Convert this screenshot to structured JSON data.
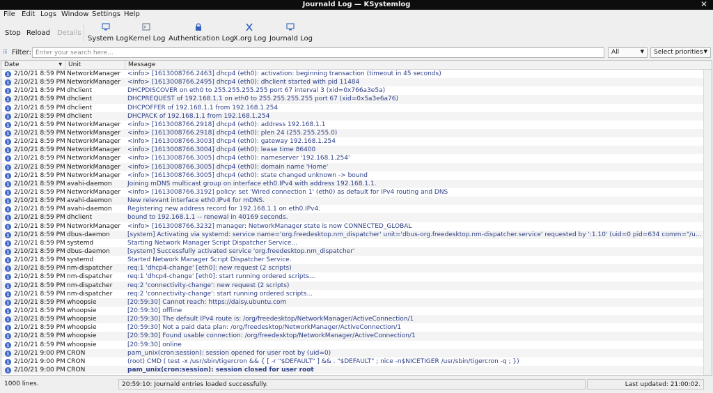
{
  "window": {
    "title": "Journald Log — KSystemlog"
  },
  "menu": [
    "File",
    "Edit",
    "Logs",
    "Window",
    "Settings",
    "Help"
  ],
  "toolbar": {
    "stop": "Stop",
    "reload": "Reload",
    "details": "Details",
    "logs": [
      {
        "label": "System Log",
        "icon": "monitor-icon"
      },
      {
        "label": "Kernel Log",
        "icon": "terminal-icon"
      },
      {
        "label": "Authentication Log",
        "icon": "lock-icon"
      },
      {
        "label": "X.org Log",
        "icon": "xorg-icon"
      },
      {
        "label": "Journald Log",
        "icon": "monitor-icon"
      }
    ]
  },
  "filter": {
    "label": "Filter:",
    "placeholder": "Enter your search here...",
    "column_select": "All",
    "priority_select": "Select priorities"
  },
  "table": {
    "columns": [
      "Date",
      "Unit",
      "Message"
    ],
    "rows": [
      {
        "date": "2/10/21 8:59 PM",
        "unit": "NetworkManager",
        "msg": "<info>  [1613008766.2463] dhcp4 (eth0): activation: beginning transaction (timeout in 45 seconds)"
      },
      {
        "date": "2/10/21 8:59 PM",
        "unit": "NetworkManager",
        "msg": "<info>  [1613008766.2495] dhcp4 (eth0): dhclient started with pid 11484"
      },
      {
        "date": "2/10/21 8:59 PM",
        "unit": "dhclient",
        "msg": "DHCPDISCOVER on eth0 to 255.255.255.255 port 67 interval 3 (xid=0x766a3e5a)"
      },
      {
        "date": "2/10/21 8:59 PM",
        "unit": "dhclient",
        "msg": "DHCPREQUEST of 192.168.1.1 on eth0 to 255.255.255.255 port 67 (xid=0x5a3e6a76)"
      },
      {
        "date": "2/10/21 8:59 PM",
        "unit": "dhclient",
        "msg": "DHCPOFFER of 192.168.1.1 from 192.168.1.254"
      },
      {
        "date": "2/10/21 8:59 PM",
        "unit": "dhclient",
        "msg": "DHCPACK of 192.168.1.1 from 192.168.1.254"
      },
      {
        "date": "2/10/21 8:59 PM",
        "unit": "NetworkManager",
        "msg": "<info>  [1613008766.2918] dhcp4 (eth0):   address 192.168.1.1"
      },
      {
        "date": "2/10/21 8:59 PM",
        "unit": "NetworkManager",
        "msg": "<info>  [1613008766.2918] dhcp4 (eth0):   plen 24 (255.255.255.0)"
      },
      {
        "date": "2/10/21 8:59 PM",
        "unit": "NetworkManager",
        "msg": "<info>  [1613008766.3003] dhcp4 (eth0):   gateway 192.168.1.254"
      },
      {
        "date": "2/10/21 8:59 PM",
        "unit": "NetworkManager",
        "msg": "<info>  [1613008766.3004] dhcp4 (eth0):   lease time 86400"
      },
      {
        "date": "2/10/21 8:59 PM",
        "unit": "NetworkManager",
        "msg": "<info>  [1613008766.3005] dhcp4 (eth0):   nameserver '192.168.1.254'"
      },
      {
        "date": "2/10/21 8:59 PM",
        "unit": "NetworkManager",
        "msg": "<info>  [1613008766.3005] dhcp4 (eth0):   domain name 'Home'"
      },
      {
        "date": "2/10/21 8:59 PM",
        "unit": "NetworkManager",
        "msg": "<info>  [1613008766.3005] dhcp4 (eth0): state changed unknown -> bound"
      },
      {
        "date": "2/10/21 8:59 PM",
        "unit": "avahi-daemon",
        "msg": "Joining mDNS multicast group on interface eth0.IPv4 with address 192.168.1.1."
      },
      {
        "date": "2/10/21 8:59 PM",
        "unit": "NetworkManager",
        "msg": "<info>  [1613008766.3192] policy: set 'Wired connection 1' (eth0) as default for IPv4 routing and DNS"
      },
      {
        "date": "2/10/21 8:59 PM",
        "unit": "avahi-daemon",
        "msg": "New relevant interface eth0.IPv4 for mDNS."
      },
      {
        "date": "2/10/21 8:59 PM",
        "unit": "avahi-daemon",
        "msg": "Registering new address record for 192.168.1.1 on eth0.IPv4."
      },
      {
        "date": "2/10/21 8:59 PM",
        "unit": "dhclient",
        "msg": "bound to 192.168.1.1 -- renewal in 40169 seconds."
      },
      {
        "date": "2/10/21 8:59 PM",
        "unit": "NetworkManager",
        "msg": "<info>  [1613008766.3232] manager: NetworkManager state is now CONNECTED_GLOBAL"
      },
      {
        "date": "2/10/21 8:59 PM",
        "unit": "dbus-daemon",
        "msg": "[system] Activating via systemd: service name='org.freedesktop.nm_dispatcher' unit='dbus-org.freedesktop.nm-dispatcher.service' requested by ':1.10' (uid=0 pid=634 comm=\"/usr/sbin/Net..."
      },
      {
        "date": "2/10/21 8:59 PM",
        "unit": "systemd",
        "msg": "Starting Network Manager Script Dispatcher Service..."
      },
      {
        "date": "2/10/21 8:59 PM",
        "unit": "dbus-daemon",
        "msg": "[system] Successfully activated service 'org.freedesktop.nm_dispatcher'"
      },
      {
        "date": "2/10/21 8:59 PM",
        "unit": "systemd",
        "msg": "Started Network Manager Script Dispatcher Service."
      },
      {
        "date": "2/10/21 8:59 PM",
        "unit": "nm-dispatcher",
        "msg": "req:1 'dhcp4-change' [eth0]: new request (2 scripts)"
      },
      {
        "date": "2/10/21 8:59 PM",
        "unit": "nm-dispatcher",
        "msg": "req:1 'dhcp4-change' [eth0]: start running ordered scripts..."
      },
      {
        "date": "2/10/21 8:59 PM",
        "unit": "nm-dispatcher",
        "msg": "req:2 'connectivity-change': new request (2 scripts)"
      },
      {
        "date": "2/10/21 8:59 PM",
        "unit": "nm-dispatcher",
        "msg": "req:2 'connectivity-change': start running ordered scripts..."
      },
      {
        "date": "2/10/21 8:59 PM",
        "unit": "whoopsie",
        "msg": "[20:59:30] Cannot reach: https://daisy.ubuntu.com"
      },
      {
        "date": "2/10/21 8:59 PM",
        "unit": "whoopsie",
        "msg": "[20:59:30] offline"
      },
      {
        "date": "2/10/21 8:59 PM",
        "unit": "whoopsie",
        "msg": "[20:59:30] The default IPv4 route is: /org/freedesktop/NetworkManager/ActiveConnection/1"
      },
      {
        "date": "2/10/21 8:59 PM",
        "unit": "whoopsie",
        "msg": "[20:59:30] Not a paid data plan: /org/freedesktop/NetworkManager/ActiveConnection/1"
      },
      {
        "date": "2/10/21 8:59 PM",
        "unit": "whoopsie",
        "msg": "[20:59:30] Found usable connection: /org/freedesktop/NetworkManager/ActiveConnection/1"
      },
      {
        "date": "2/10/21 8:59 PM",
        "unit": "whoopsie",
        "msg": "[20:59:30] online"
      },
      {
        "date": "2/10/21 9:00 PM",
        "unit": "CRON",
        "msg": "pam_unix(cron:session): session opened for user root by (uid=0)"
      },
      {
        "date": "2/10/21 9:00 PM",
        "unit": "CRON",
        "msg": "(root) CMD (   test -x /usr/sbin/tigercron && { [ -r \"$DEFAULT\" ] && . \"$DEFAULT\" ; nice -n$NICETIGER /usr/sbin/tigercron -q ; })"
      },
      {
        "date": "2/10/21 9:00 PM",
        "unit": "CRON",
        "msg": "pam_unix(cron:session): session closed for user root",
        "bold": true
      }
    ]
  },
  "status": {
    "lines": "1000 lines.",
    "message": "20:59:10: Journald entries loaded successfully.",
    "updated": "Last updated: 21:00:02."
  },
  "colors": {
    "titlebar": "#0d0d0d",
    "message_text": "#2c3e86",
    "info_icon": "#3d66c8"
  }
}
